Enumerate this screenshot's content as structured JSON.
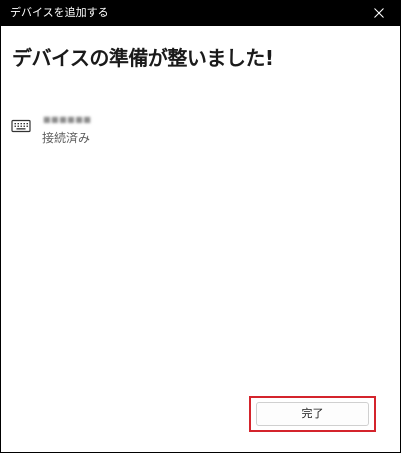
{
  "window": {
    "title": "デバイスを追加する"
  },
  "main": {
    "heading": "デバイスの準備が整いました!",
    "device": {
      "icon": "keyboard-icon",
      "name": "■■■■■■",
      "status": "接続済み"
    },
    "done_label": "完了"
  },
  "colors": {
    "titlebar": "#000000",
    "content_bg": "#ffffff",
    "highlight": "#d4242c"
  }
}
